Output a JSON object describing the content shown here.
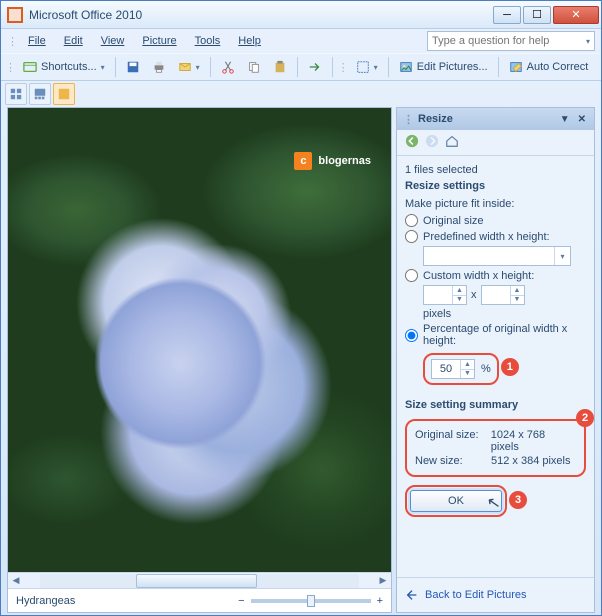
{
  "window": {
    "title": "Microsoft Office 2010"
  },
  "menu": {
    "file": "File",
    "edit": "Edit",
    "view": "View",
    "picture": "Picture",
    "tools": "Tools",
    "help": "Help"
  },
  "help_search": {
    "placeholder": "Type a question for help"
  },
  "toolbar": {
    "shortcuts": "Shortcuts...",
    "edit_pictures": "Edit Pictures...",
    "auto_correct": "Auto Correct"
  },
  "taskpane": {
    "title": "Resize",
    "files_selected": "1 files selected",
    "section_resize": "Resize settings",
    "fit_label": "Make picture fit inside:",
    "opt_original": "Original size",
    "opt_predefined": "Predefined width x height:",
    "opt_custom": "Custom width x height:",
    "pixels": "pixels",
    "opt_percentage": "Percentage of original width x height:",
    "percent_value": "50",
    "percent_sign": "%",
    "section_summary": "Size setting summary",
    "orig_label": "Original size:",
    "orig_value": "1024 x 768 pixels",
    "new_label": "New size:",
    "new_value": "512 x 384 pixels",
    "ok": "OK",
    "back": "Back to Edit Pictures"
  },
  "status": {
    "filename": "Hydrangeas"
  },
  "callouts": {
    "c1": "1",
    "c2": "2",
    "c3": "3"
  },
  "watermark": {
    "text": "blogernas",
    "logo": "c"
  }
}
